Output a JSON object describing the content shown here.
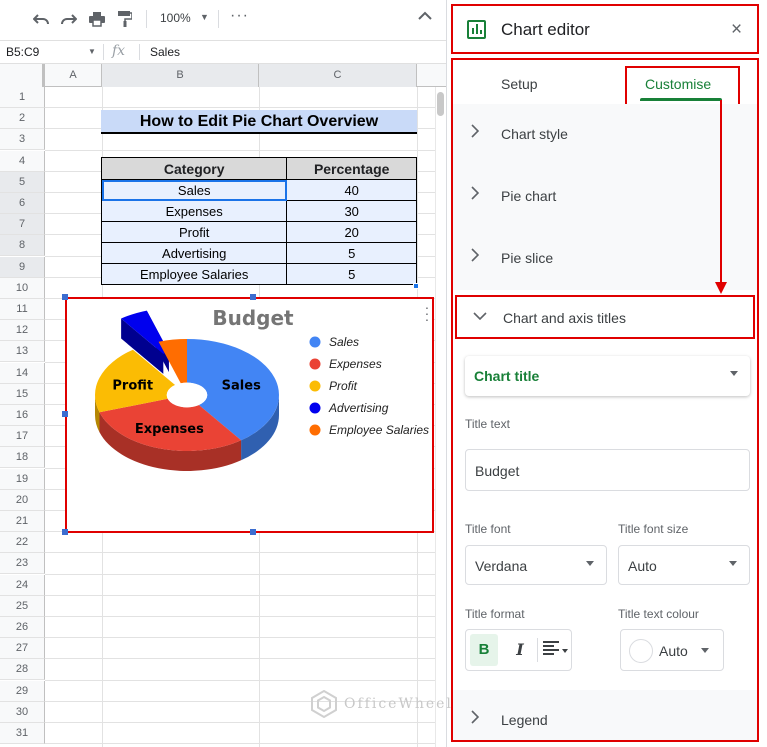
{
  "toolbar": {
    "zoom": "100%",
    "more": "⋮"
  },
  "formula_bar": {
    "name_box": "B5:C9",
    "fx": "fx",
    "formula": "Sales"
  },
  "columns": [
    "A",
    "B",
    "C"
  ],
  "rows": [
    "1",
    "2",
    "3",
    "4",
    "5",
    "6",
    "7",
    "8",
    "9",
    "10",
    "11",
    "12",
    "13",
    "14",
    "15",
    "16",
    "17",
    "18",
    "19",
    "20",
    "21",
    "22",
    "23",
    "24",
    "25",
    "26",
    "27",
    "28",
    "29",
    "30",
    "31"
  ],
  "sheet": {
    "title": "How to Edit Pie Chart Overview",
    "table_headers": [
      "Category",
      "Percentage"
    ],
    "table_rows": [
      [
        "Sales",
        "40"
      ],
      [
        "Expenses",
        "30"
      ],
      [
        "Profit",
        "20"
      ],
      [
        "Advertising",
        "5"
      ],
      [
        "Employee Salaries",
        "5"
      ]
    ]
  },
  "chart_data": {
    "type": "pie",
    "title": "Budget",
    "categories": [
      "Sales",
      "Expenses",
      "Profit",
      "Advertising",
      "Employee Salaries"
    ],
    "values": [
      40,
      30,
      20,
      5,
      5
    ],
    "colors": [
      "#4285f4",
      "#ea4335",
      "#fbbc04",
      "#0000ee",
      "#ff6d01"
    ],
    "slice_labels": [
      "Sales",
      "Expenses",
      "Profit"
    ],
    "legend_position": "right",
    "three_d": true,
    "exploded_slice": "Advertising"
  },
  "panel": {
    "title": "Chart editor",
    "close": "×",
    "tabs": {
      "setup": "Setup",
      "customise": "Customise"
    },
    "sections": {
      "chart_style": "Chart style",
      "pie_chart": "Pie chart",
      "pie_slice": "Pie slice",
      "axis_titles": "Chart and axis titles",
      "legend": "Legend"
    },
    "title_select": "Chart title",
    "title_text_label": "Title text",
    "title_text_value": "Budget",
    "title_font_label": "Title font",
    "title_font_value": "Verdana",
    "title_font_size_label": "Title font size",
    "title_font_size_value": "Auto",
    "title_format_label": "Title format",
    "format_bold": "B",
    "format_italic": "I",
    "title_colour_label": "Title text colour",
    "title_colour_value": "Auto"
  },
  "watermark": "OfficeWheel"
}
